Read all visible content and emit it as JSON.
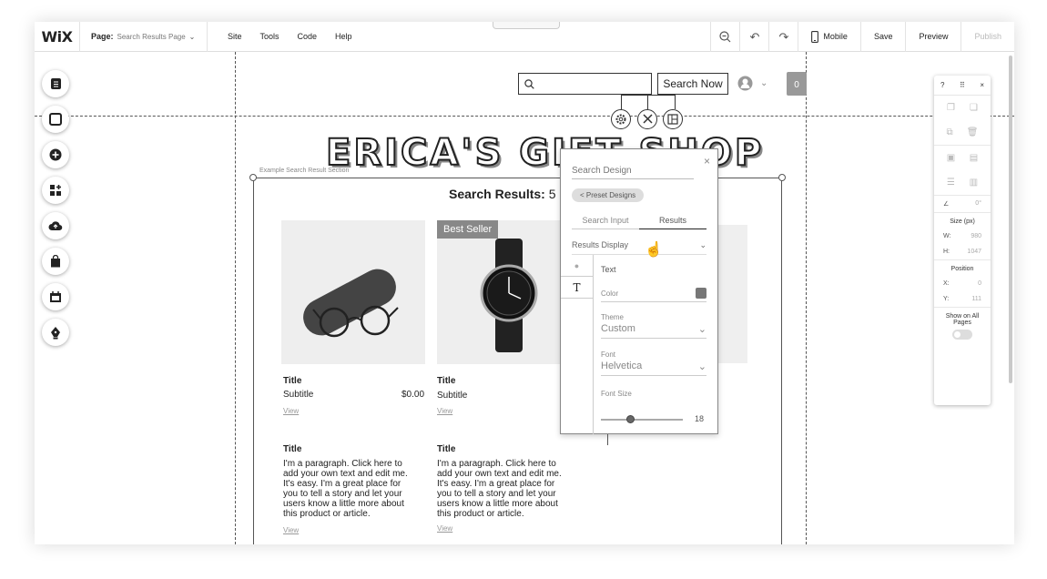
{
  "topbar": {
    "logo": "WiX",
    "page_label": "Page:",
    "page_value": "Search Results Page",
    "menu": [
      "Site",
      "Tools",
      "Code",
      "Help"
    ],
    "mobile_label": "Mobile",
    "save_label": "Save",
    "preview_label": "Preview",
    "publish_label": "Publish",
    "handle_glyph": "⌃"
  },
  "header": {
    "search_button": "Search Now",
    "cart_count": "0",
    "shop_title": "ERICA'S GIFT SHOP"
  },
  "section": {
    "label": "Example Search Result Section",
    "results_title": "Search Results:",
    "results_count": "5"
  },
  "products": [
    {
      "title": "Title",
      "subtitle": "Subtitle",
      "price": "$0.00",
      "view": "View",
      "badge": ""
    },
    {
      "title": "Title",
      "subtitle": "Subtitle",
      "price": "",
      "view": "View",
      "badge": "Best Seller"
    }
  ],
  "articles": [
    {
      "title": "Title",
      "text": "I'm a paragraph. Click here to add your own text and edit me. It's easy. I'm a great place for you to tell a story and let your users know a little more about this product or article.",
      "view": "View"
    },
    {
      "title": "Title",
      "text": "I'm a paragraph. Click here to add your own text and edit me. It's easy. I'm a great place for you to tell a story and let your users know a little more about this product or article.",
      "view": "View"
    }
  ],
  "design_panel": {
    "search_placeholder": "Search Design",
    "preset": "< Preset Designs",
    "tab_search_input": "Search Input",
    "tab_results": "Results",
    "results_display": "Results Display",
    "text_label": "Text",
    "color_label": "Color",
    "theme_label": "Theme",
    "theme_value": "Custom",
    "font_label": "Font",
    "font_value": "Helvetica",
    "font_size_label": "Font Size",
    "font_size_value": "18",
    "text_tab_glyph": "T"
  },
  "right_panel": {
    "help": "?",
    "size_label": "Size (px)",
    "w_label": "W:",
    "w_value": "980",
    "h_label": "H:",
    "h_value": "1047",
    "position_label": "Position",
    "x_label": "X:",
    "x_value": "0",
    "y_label": "Y:",
    "y_value": "111",
    "rotation_value": "0°",
    "show_all_label": "Show on All Pages"
  },
  "colors": {
    "accent": "#555555",
    "badge": "#888888"
  }
}
